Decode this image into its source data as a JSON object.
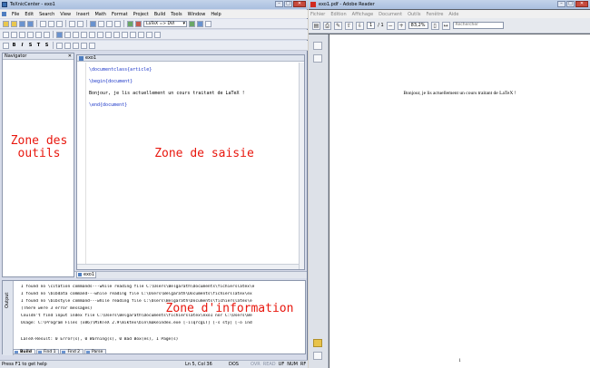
{
  "texnic": {
    "title": "TeXnicCenter - exo1",
    "window_buttons": [
      "–",
      "□",
      "✕"
    ],
    "menu": [
      "File",
      "Edit",
      "Search",
      "View",
      "Insert",
      "Math",
      "Format",
      "Project",
      "Build",
      "Tools",
      "Window",
      "Help"
    ],
    "toolbar": {
      "output_profile": "LaTeX => DVI"
    },
    "format_toolbar": [
      "B",
      "I",
      "S",
      "T",
      "S"
    ],
    "navigator": {
      "title": "Navigator",
      "label": "Zone des outils"
    },
    "editor": {
      "tab": "exo1",
      "lines": [
        "\\documentclass{article}",
        "\\begin{document}",
        "Bonjour, je lis actuellement un cours traitant de LaTeX !",
        "\\end{document}"
      ],
      "label": "Zone de saisie"
    },
    "doc_tab": "exo1",
    "output": {
      "side_label": "Output",
      "lines": [
        "I found no \\citation commands---while reading file C:\\Users\\Belgarath\\Documents\\fichierslatex\\e",
        "I found no \\bibdata command---while reading file C:\\Users\\Belgarath\\Documents\\fichierslatex\\ex",
        "I found no \\bibstyle command---while reading file C:\\Users\\Belgarath\\Documents\\fichierslatex\\e",
        "(There were 3 error messages)",
        "Couldn't find input index file C:\\Users\\Belgarath\\Documents\\fichierslatex\\exo1 nor C:\\Users\\Be",
        "Usage: C:\\Program Files (x86)\\MiKTeX 2.9\\miktex\\bin\\makeindex.exe [-ilqrcgLT] [-s sty] [-o ind",
        "",
        "LaTeX-Result: 0 Error(s), 0 Warning(s), 0 Bad Box(es), 1 Page(s)"
      ],
      "label": "Zone d'information",
      "tabs": [
        "Build",
        "Find 1",
        "Find 2",
        "Parse"
      ]
    },
    "status": {
      "help": "Press F1 to get help",
      "position": "Ln 5, Col 36",
      "encoding": "DOS",
      "keys": [
        "OVR",
        "READ",
        "UF",
        "NUM",
        "RF"
      ]
    }
  },
  "reader": {
    "title": "exo1.pdf - Adobe Reader",
    "menu": [
      "Fichier",
      "Edition",
      "Affichage",
      "Document",
      "Outils",
      "Fenêtre",
      "Aide"
    ],
    "page_current": "1",
    "page_total": "/ 1",
    "zoom": "83,2%",
    "search_placeholder": "Rechercher",
    "page_text": "Bonjour, je lis actuellement un cours traitant de LaTeX !",
    "page_number": "1"
  },
  "colors": {
    "annotation_red": "#e8170e",
    "latex_keyword": "#1a35c8"
  }
}
